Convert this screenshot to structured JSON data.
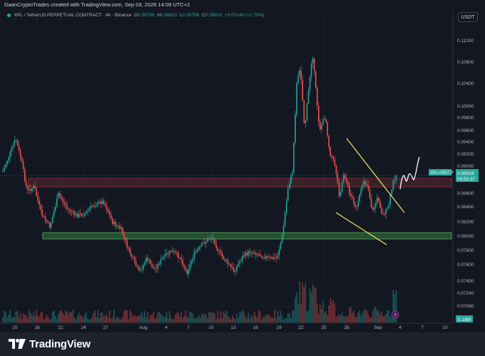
{
  "header": {
    "created_by": "DaanCryptoTrades created with TradingView.com, Sep 03, 2026 14:09 UTC+2"
  },
  "legend": {
    "symbol_info": "XPL / TetherUS PERPETUAL CONTRACT · 4h · Binance",
    "open_label": "O",
    "open": "0.08768",
    "high_label": "H",
    "high": "0.08922",
    "low_label": "L",
    "low": "0.08766",
    "close_label": "C",
    "close": "0.08918",
    "change": "+0.00149 (+1.70%)"
  },
  "currency_button": "USDT",
  "price_axis": {
    "ticks": [
      "0.11200",
      "0.10800",
      "0.10400",
      "0.10000",
      "0.09800",
      "0.09600",
      "0.09400",
      "0.09200",
      "0.09000",
      "0.08600",
      "0.08400",
      "0.08200",
      "0.08000",
      "0.07800",
      "0.07600",
      "0.07400",
      "0.07240",
      "0.07080"
    ]
  },
  "time_axis": {
    "ticks": [
      "15",
      "18",
      "21",
      "24",
      "27",
      "Aug",
      "4",
      "7",
      "10",
      "13",
      "16",
      "19",
      "22",
      "25",
      "28",
      "Sep",
      "4",
      "7",
      "10"
    ]
  },
  "price_tag": {
    "symbol": "XPLUSDT.P",
    "price": "0.08918",
    "countdown": "03:50:37"
  },
  "volume_tag": "5.18M",
  "colors": {
    "background": "#131722",
    "up_candle": "#26a69a",
    "down_candle": "#ef5350",
    "resistance_zone": "#ef5350",
    "support_zone": "#4caf50",
    "wedge_lines": "#f5e663",
    "price_tag": "#26a69a",
    "volume_tag": "#26a69a"
  },
  "branding": {
    "logo": "tradingview-logo-icon",
    "name": "TradingView"
  }
}
